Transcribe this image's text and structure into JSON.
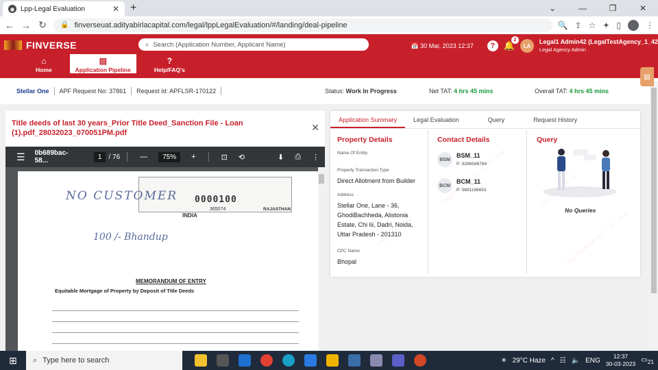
{
  "browser": {
    "tab_title": "Lpp-Legal Evaluation",
    "url": "finverseuat.adityabirlacapital.com/legal/lppLegalEvaluation/#/landing/deal-pipeline"
  },
  "header": {
    "brand": "FINVERSE",
    "search_placeholder": "Search (Application Number, Applicant Name)",
    "date": "30 Mar, 2023 12:37",
    "notif_count": "2",
    "avatar_initials": "LA",
    "user_name": "Legal1 Admin42 (LegalTestAgency_1_42",
    "user_role": "Legal Agency Admin",
    "nav": [
      {
        "label": "Home"
      },
      {
        "label": "Application Pipeline"
      },
      {
        "label": "Help/FAQ's"
      }
    ]
  },
  "info": {
    "company": "Stellar One",
    "apf": "APF Request No: 37861",
    "request_id": "Request Id: APFLSR-170122",
    "status_label": "Status:",
    "status_value": "Work In Progress",
    "net_tat_label": "Net TAT:",
    "net_tat_value": "4 hrs 45 mins",
    "overall_tat_label": "Overall TAT:",
    "overall_tat_value": "4 hrs 45 mins"
  },
  "document": {
    "title": "Title deeds of last 30 years_Prior Title Deed_Sanction File - Loan (1).pdf_28032023_070051PM.pdf",
    "pdf_name": "0b689bac-58...",
    "page": "1",
    "total_pages": "/ 76",
    "zoom": "75%",
    "stamp_number": "0000100",
    "stamp_sub": "365074",
    "stamp_state": "RAJASTHAN",
    "stamp_country": "INDIA",
    "hand_note_1": "NO  CUSTOMER",
    "hand_note_2": "100 /- Bhandup",
    "memo_title": "MEMORANDUM OF ENTRY",
    "memo_sub": "Equitable Mortgage of Property by Deposit of Title Deeds"
  },
  "panel": {
    "tabs": [
      "Application Summary",
      "Legal Evaluation",
      "Query",
      "Request History"
    ],
    "property_title": "Property Details",
    "entity_label": "Name Of Entity",
    "transaction_label": "Property Transaction Type",
    "transaction_value": "Direct Allotment from Builder",
    "address_label": "Address",
    "address_value": "Stellar One, Lane - 36, GhodiBachheda, Alistonia Estate, Chi Iii, Dadri, Noida, Uttar Pradesh - 201310",
    "cpc_label": "CPC Name",
    "cpc_value": "Bhopal",
    "contact_title": "Contact Details",
    "contacts": [
      {
        "initials": "BSM",
        "name": "BSM_11",
        "phone": "P: 8286546784"
      },
      {
        "initials": "BCM",
        "name": "BCM_11",
        "phone": "P: 9881186653"
      }
    ],
    "query_title": "Query",
    "no_queries": "No Queries"
  },
  "taskbar": {
    "search_placeholder": "Type here to search",
    "weather": "29°C  Haze",
    "lang": "ENG",
    "time": "12:37",
    "date": "30-03-2023",
    "notif": "21"
  }
}
